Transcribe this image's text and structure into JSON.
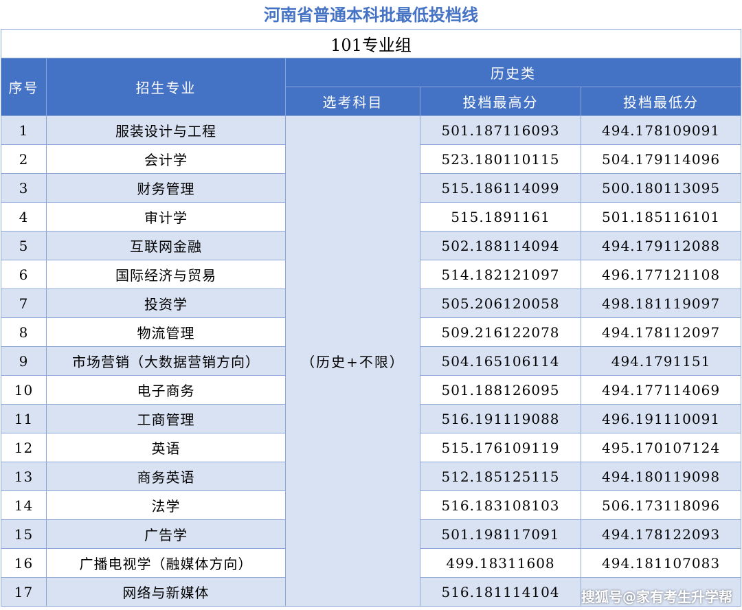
{
  "title": "河南省普通本科批最低投档线",
  "group": "101专业组",
  "headers": {
    "seq": "序号",
    "major": "招生专业",
    "category": "历史类",
    "subject": "选考科目",
    "max": "投档最高分",
    "min": "投档最低分"
  },
  "subject_value": "（历史+不限）",
  "rows": [
    {
      "seq": "1",
      "major": "服装设计与工程",
      "max": "501.187116093",
      "min": "494.178109091"
    },
    {
      "seq": "2",
      "major": "会计学",
      "max": "523.180110115",
      "min": "504.179114096"
    },
    {
      "seq": "3",
      "major": "财务管理",
      "max": "515.186114099",
      "min": "500.180113095"
    },
    {
      "seq": "4",
      "major": "审计学",
      "max": "515.1891161",
      "min": "501.185116101"
    },
    {
      "seq": "5",
      "major": "互联网金融",
      "max": "502.188114094",
      "min": "494.179112088"
    },
    {
      "seq": "6",
      "major": "国际经济与贸易",
      "max": "514.182121097",
      "min": "496.177121108"
    },
    {
      "seq": "7",
      "major": "投资学",
      "max": "505.206120058",
      "min": "498.181119097"
    },
    {
      "seq": "8",
      "major": "物流管理",
      "max": "509.216122078",
      "min": "494.178112097"
    },
    {
      "seq": "9",
      "major": "市场营销（大数据营销方向）",
      "max": "504.165106114",
      "min": "494.1791151"
    },
    {
      "seq": "10",
      "major": "电子商务",
      "max": "501.188126095",
      "min": "494.177114069"
    },
    {
      "seq": "11",
      "major": "工商管理",
      "max": "516.191119088",
      "min": "496.191110091"
    },
    {
      "seq": "12",
      "major": "英语",
      "max": "515.176109119",
      "min": "495.170107124"
    },
    {
      "seq": "13",
      "major": "商务英语",
      "max": "512.185125115",
      "min": "494.180119098"
    },
    {
      "seq": "14",
      "major": "法学",
      "max": "516.183108103",
      "min": "506.173118096"
    },
    {
      "seq": "15",
      "major": "广告学",
      "max": "501.198117091",
      "min": "494.178122093"
    },
    {
      "seq": "16",
      "major": "广播电视学（融媒体方向）",
      "max": "499.18311608",
      "min": "494.181107083"
    },
    {
      "seq": "17",
      "major": "网络与新媒体",
      "max": "516.181114104",
      "min": ""
    }
  ],
  "watermark": "搜狐号@家有考生升学帮",
  "colors": {
    "title": "#4472c4",
    "header_bg": "#4472c4",
    "band": "#d9e2f3"
  }
}
